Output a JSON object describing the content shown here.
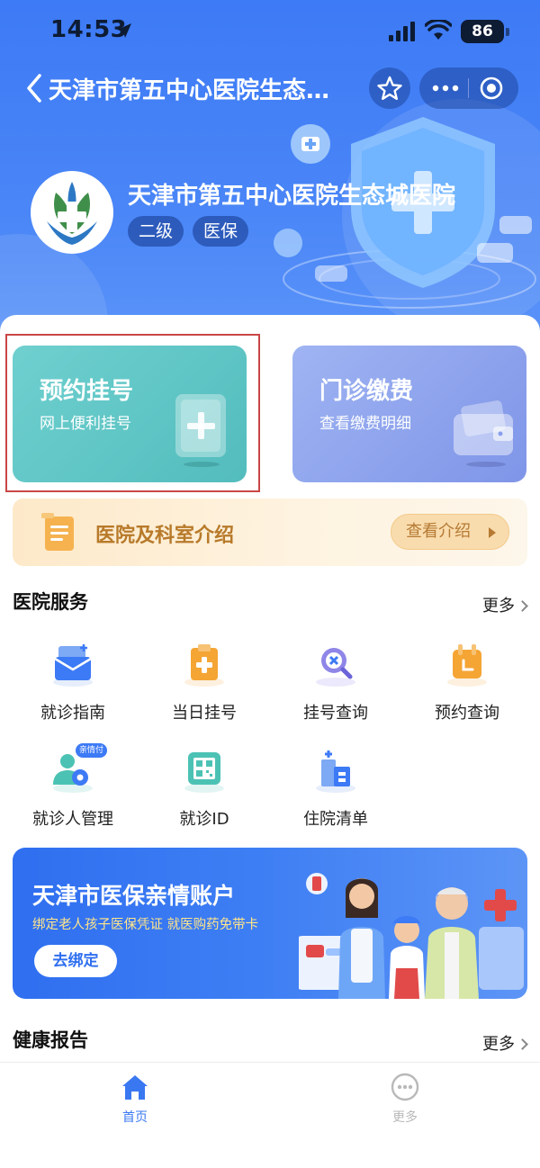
{
  "status_bar": {
    "time": "14:53",
    "battery": "86"
  },
  "nav": {
    "title": "天津市第五中心医院生态…"
  },
  "hospital": {
    "name": "天津市第五中心医院生态城医院",
    "tags": [
      "二级",
      "医保"
    ]
  },
  "quick_cards": [
    {
      "title": "预约挂号",
      "subtitle": "网上便利挂号"
    },
    {
      "title": "门诊缴费",
      "subtitle": "查看缴费明细"
    }
  ],
  "intro": {
    "label": "医院及科室介绍",
    "button": "查看介绍"
  },
  "services": {
    "title": "医院服务",
    "more": "更多",
    "items": [
      {
        "label": "就诊指南",
        "icon": "guide-envelope-icon"
      },
      {
        "label": "当日挂号",
        "icon": "clipboard-plus-icon"
      },
      {
        "label": "挂号查询",
        "icon": "search-cross-icon"
      },
      {
        "label": "预约查询",
        "icon": "calendar-icon"
      },
      {
        "label": "就诊人管理",
        "icon": "patient-manage-icon",
        "badge": "亲情付"
      },
      {
        "label": "就诊ID",
        "icon": "qr-id-icon"
      },
      {
        "label": "住院清单",
        "icon": "hospital-building-icon"
      }
    ]
  },
  "banner": {
    "title": "天津市医保亲情账户",
    "subtitle": "绑定老人孩子医保凭证 就医购药免带卡",
    "button": "去绑定"
  },
  "health_report": {
    "title": "健康报告",
    "more": "更多"
  },
  "tabbar": [
    {
      "label": "首页",
      "active": true
    },
    {
      "label": "更多",
      "active": false
    }
  ],
  "colors": {
    "primary": "#3d7af5",
    "tab_active": "#3a78f2",
    "tab_inactive": "#b9b9b9",
    "teal_card": "#5ec4c5",
    "purple_card": "#8ba0ec"
  }
}
